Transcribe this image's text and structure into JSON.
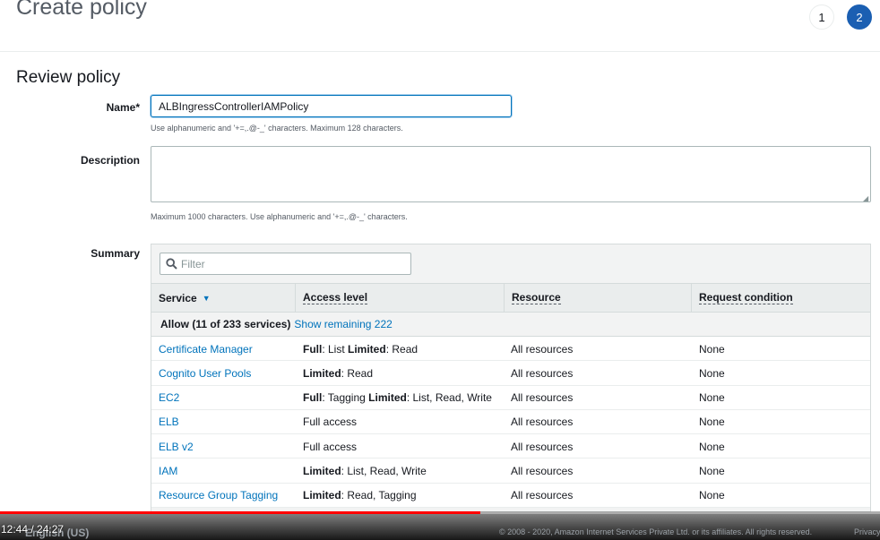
{
  "header": {
    "title": "Create policy",
    "steps": [
      "1",
      "2"
    ]
  },
  "section_title": "Review policy",
  "form": {
    "name_label": "Name*",
    "name_value": "ALBIngressControllerIAMPolicy",
    "name_hint": "Use alphanumeric and '+=,.@-_' characters. Maximum 128 characters.",
    "description_label": "Description",
    "description_value": "",
    "description_hint": "Maximum 1000 characters. Use alphanumeric and '+=,.@-_' characters.",
    "summary_label": "Summary"
  },
  "summary": {
    "filter_placeholder": "Filter",
    "columns": {
      "service": "Service",
      "access": "Access level",
      "resource": "Resource",
      "condition": "Request condition"
    },
    "allow_text": "Allow (11 of 233 services)",
    "show_remaining": "Show remaining 222",
    "rows": [
      {
        "service": "Certificate Manager",
        "access": [
          {
            "b": "Full"
          },
          {
            "t": ": List "
          },
          {
            "b": "Limited"
          },
          {
            "t": ": Read"
          }
        ],
        "resource": "All resources",
        "condition": "None"
      },
      {
        "service": "Cognito User Pools",
        "access": [
          {
            "b": "Limited"
          },
          {
            "t": ": Read"
          }
        ],
        "resource": "All resources",
        "condition": "None"
      },
      {
        "service": "EC2",
        "access": [
          {
            "b": "Full"
          },
          {
            "t": ": Tagging "
          },
          {
            "b": "Limited"
          },
          {
            "t": ": List, Read, Write"
          }
        ],
        "resource": "All resources",
        "condition": "None"
      },
      {
        "service": "ELB",
        "access": [
          {
            "t": "Full access"
          }
        ],
        "resource": "All resources",
        "condition": "None"
      },
      {
        "service": "ELB v2",
        "access": [
          {
            "t": "Full access"
          }
        ],
        "resource": "All resources",
        "condition": "None"
      },
      {
        "service": "IAM",
        "access": [
          {
            "b": "Limited"
          },
          {
            "t": ": List, Read, Write"
          }
        ],
        "resource": "All resources",
        "condition": "None"
      },
      {
        "service": "Resource Group Tagging",
        "access": [
          {
            "b": "Limited"
          },
          {
            "t": ": Read, Tagging"
          }
        ],
        "resource": "All resources",
        "condition": "None"
      }
    ]
  },
  "video": {
    "time": "12:44 / 24:27",
    "progress": 0.546
  },
  "footer": {
    "language": "English (US)",
    "copyright": "© 2008 - 2020, Amazon Internet Services Private Ltd. or its affiliates. All rights reserved.",
    "privacy": "Privacy"
  },
  "colors": {
    "link": "#0073bb",
    "step_active": "#1b5fb2",
    "progress": "#ff0000"
  }
}
